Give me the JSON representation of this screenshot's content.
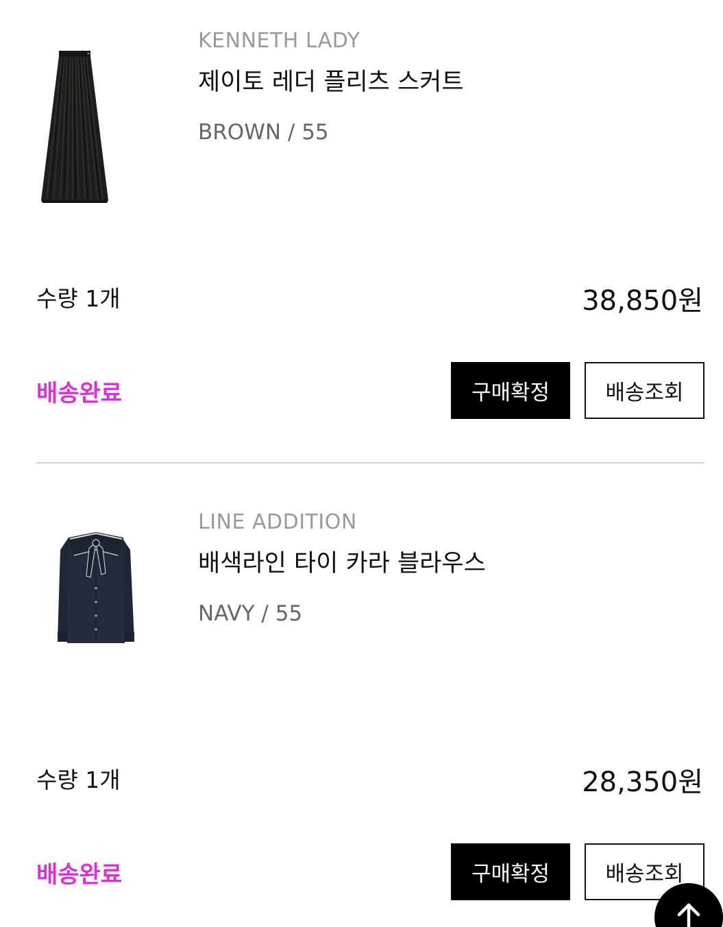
{
  "orders": [
    {
      "brand": "KENNETH LADY",
      "product_name": "제이토 레더 플리츠 스커트",
      "option": "BROWN / 55",
      "quantity": "수량 1개",
      "price": "38,850원",
      "status": "배송완료",
      "status_color": "#e02cdd",
      "image_icon": "pleated-leather-skirt-image",
      "buttons": {
        "confirm": "구매확정",
        "track": "배송조회"
      }
    },
    {
      "brand": "LINE ADDITION",
      "product_name": "배색라인 타이 카라 블라우스",
      "option": "NAVY / 55",
      "quantity": "수량 1개",
      "price": "28,350원",
      "status": "배송완료",
      "status_color": "#e02cdd",
      "image_icon": "navy-tie-collar-blouse-image",
      "buttons": {
        "confirm": "구매확정",
        "track": "배송조회"
      }
    }
  ],
  "scroll_top_icon": "arrow-up-icon"
}
